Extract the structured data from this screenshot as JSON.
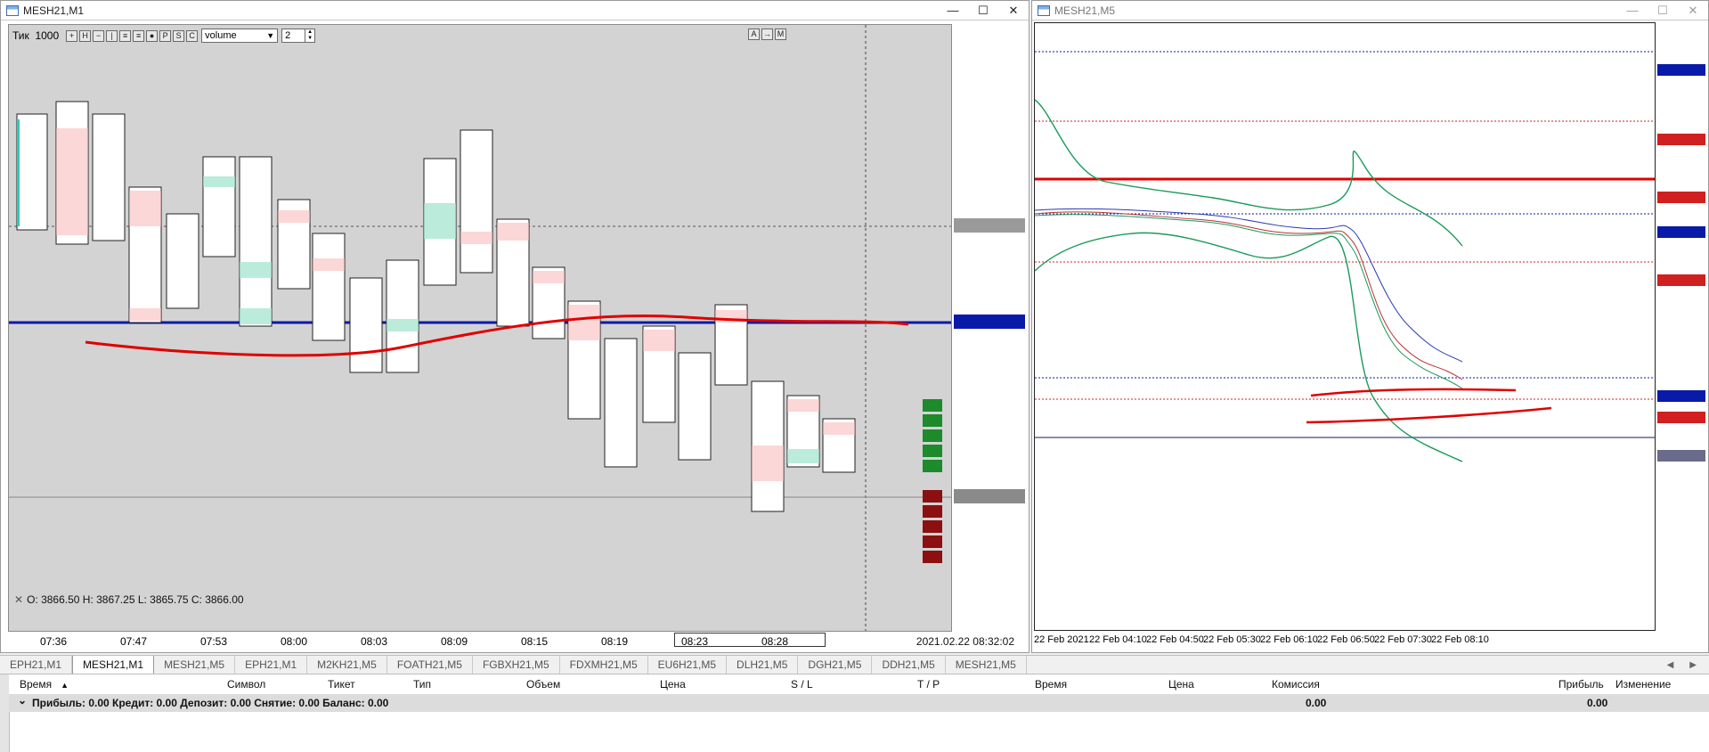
{
  "windows": {
    "m1": {
      "title": "MESH21,M1",
      "buttons": {
        "minimize": "—",
        "maximize": "☐",
        "close": "✕"
      }
    },
    "m5": {
      "title": "MESH21,M5",
      "buttons": {
        "minimize": "—",
        "maximize": "☐",
        "close": "✕"
      }
    }
  },
  "m1_toolbar": {
    "tick_label": "Тик",
    "tick_value": "1000",
    "buttons": [
      "+",
      "H",
      "−",
      "|",
      "≡",
      "≡",
      "●",
      "P",
      "S",
      "C"
    ],
    "select_value": "volume",
    "spin_value": "2",
    "right_buttons": [
      "A",
      "→",
      "M"
    ]
  },
  "m1_ohlc": "O: 3866.50   H: 3867.25   L: 3865.75   C: 3866.00",
  "m1_time_axis": {
    "ticks": [
      "07:36",
      "07:47",
      "07:53",
      "08:00",
      "08:03",
      "08:09",
      "08:15",
      "08:19",
      "08:23",
      "08:28"
    ],
    "current_time": "2021.02.22 08:32:02"
  },
  "m5_time_axis": {
    "ticks": [
      "22 Feb 2021",
      "22 Feb 04:10",
      "22 Feb 04:50",
      "22 Feb 05:30",
      "22 Feb 06:10",
      "22 Feb 06:50",
      "22 Feb 07:30",
      "22 Feb 08:10"
    ]
  },
  "tabs": [
    {
      "label": "EPH21,M1",
      "active": false
    },
    {
      "label": "MESH21,M1",
      "active": true
    },
    {
      "label": "MESH21,M5",
      "active": false
    },
    {
      "label": "EPH21,M1",
      "active": false
    },
    {
      "label": "M2KH21,M5",
      "active": false
    },
    {
      "label": "FOATH21,M5",
      "active": false
    },
    {
      "label": "FGBXH21,M5",
      "active": false
    },
    {
      "label": "FDXMH21,M5",
      "active": false
    },
    {
      "label": "EU6H21,M5",
      "active": false
    },
    {
      "label": "DLH21,M5",
      "active": false
    },
    {
      "label": "DGH21,M5",
      "active": false
    },
    {
      "label": "DDH21,M5",
      "active": false
    },
    {
      "label": "MESH21,M5",
      "active": false
    }
  ],
  "tab_arrows": {
    "left": "◀",
    "right": "▶"
  },
  "trade_table": {
    "columns": [
      "Время",
      "Символ",
      "Тикет",
      "Тип",
      "Объем",
      "Цена",
      "S / L",
      "T / P",
      "Время",
      "Цена",
      "Комиссия",
      "Прибыль",
      "Изменение"
    ],
    "sort_indicator": "▲",
    "summary": {
      "toggle": "⌄",
      "text": "Прибыль: 0.00  Кредит: 0.00  Депозит: 0.00  Снятие: 0.00  Баланс: 0.00",
      "commission": "0.00",
      "profit": "0.00"
    }
  },
  "colors": {
    "bid_cell": "#f7b6b6",
    "ask_cell": "#9ee3cc",
    "level_line": "#0a1aa8",
    "drawn_line": "#e00000",
    "ma_green": "#1a9a5a"
  }
}
